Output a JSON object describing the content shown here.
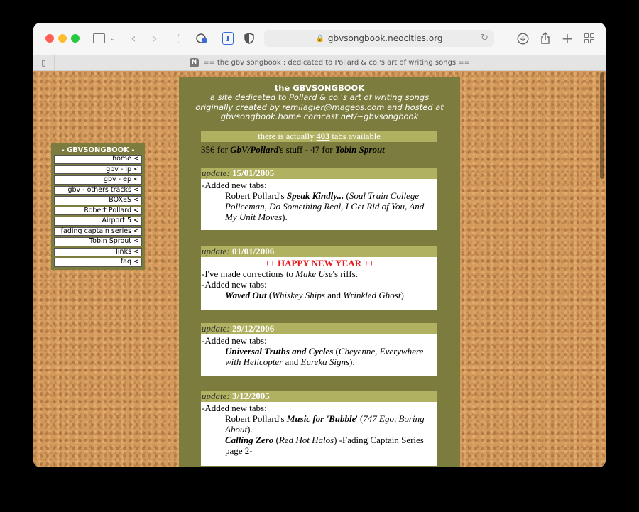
{
  "browser": {
    "url": "gbvsongbook.neocities.org",
    "tab_title": "== the gbv songbook : dedicated to Pollard & co.'s art of writing songs ==",
    "favicon_letter": "N"
  },
  "site": {
    "title": "the GBVSONGBOOK",
    "subtitle_1": "a site dedicated to Pollard & co.'s art of writing songs",
    "subtitle_2": "originally created by remilagier@mageos.com and hosted at",
    "subtitle_3": "gbvsongbook.home.comcast.net/~gbvsongbook",
    "count_pre": "there is actually ",
    "count_num": "403",
    "count_post": " tabs available",
    "split_a": "356 for ",
    "split_b": "GbV/Pollard",
    "split_c": "'s stuff - 47 for ",
    "split_d": "Tobin Sprout"
  },
  "nav": {
    "title": "- GBVSONGBOOK -",
    "items": [
      "home <",
      "gbv - lp <",
      "gbv - ep <",
      "gbv - others tracks <",
      "BOXES <",
      "Robert Pollard <",
      "Airport 5 <",
      "fading captain series <",
      "Tobin Sprout <",
      "links <",
      "faq <"
    ]
  },
  "updates": {
    "label": "update:",
    "u1": {
      "date": "15/01/2005",
      "l1": "-Added new tabs:",
      "a": "Robert Pollard's ",
      "b": "Speak Kindly...",
      "c": " (",
      "d": "Soul Train College Policeman, Do Something Real, I Get Rid of You, And My Unit Moves",
      "e": ")."
    },
    "u2": {
      "date": "01/01/2006",
      "banner": "++ HAPPY NEW YEAR ++",
      "l1a": "-I've made corrections to ",
      "l1b": "Make Use",
      "l1c": "'s riffs.",
      "l2": "-Added new tabs:",
      "a": "Waved Out",
      "b": " (",
      "c": "Whiskey Ships",
      "d": " and ",
      "e": "Wrinkled Ghost",
      "f": ")."
    },
    "u3": {
      "date": "29/12/2006",
      "l1": "-Added new tabs:",
      "a": "Universal Truths and Cycles",
      "b": " (",
      "c": "Cheyenne, Everywhere with Helicopter",
      "d": " and ",
      "e": "Eureka Signs",
      "f": ")."
    },
    "u4": {
      "date": "3/12/2005",
      "l1": "-Added new tabs:",
      "a": "Robert Pollard's ",
      "b": "Music for '",
      "c": "Bubble",
      "d": "' (",
      "e": "747 Ego, Boring About",
      "f": ").",
      "g": "Calling Zero",
      "h": " (",
      "i": "Red Hot Halos",
      "j": ") -Fading Captain Series page 2-"
    }
  }
}
